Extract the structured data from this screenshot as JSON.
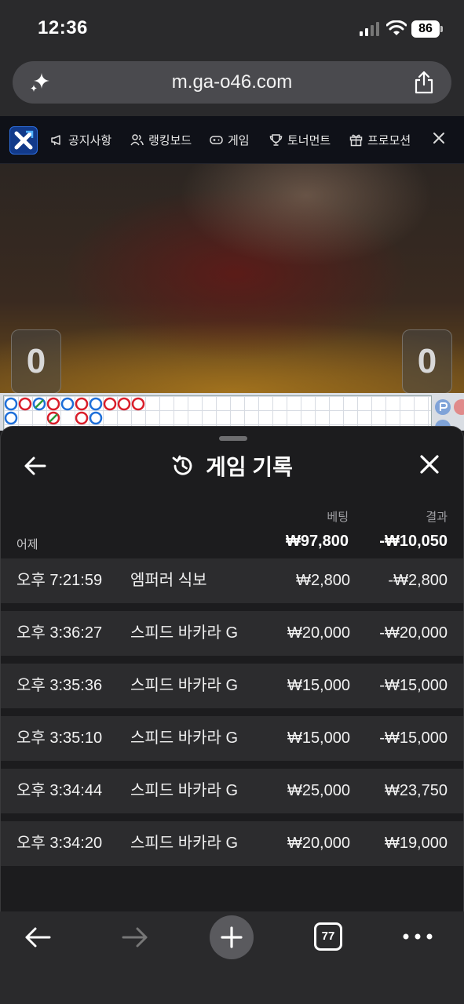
{
  "status_bar": {
    "time": "12:36",
    "battery": "86"
  },
  "browser": {
    "url": "m.ga-o46.com",
    "open_tabs": "77"
  },
  "site_nav": {
    "items": [
      {
        "label": "공지사항",
        "icon": "megaphone-icon"
      },
      {
        "label": "랭킹보드",
        "icon": "users-icon"
      },
      {
        "label": "게임",
        "icon": "gamepad-icon"
      },
      {
        "label": "토너먼트",
        "icon": "trophy-icon"
      },
      {
        "label": "프로모션",
        "icon": "gift-icon"
      }
    ]
  },
  "video": {
    "score_left": "0",
    "score_right": "0"
  },
  "game_history": {
    "title": "게임 기록",
    "col_bet": "베팅",
    "col_result": "결과",
    "summary": {
      "label": "어제",
      "bet": "₩97,800",
      "result": "-₩10,050"
    },
    "rows": [
      {
        "time": "오후 7:21:59",
        "game": "엠퍼러 식보",
        "bet": "₩2,800",
        "result": "-₩2,800"
      },
      {
        "time": "오후 3:36:27",
        "game": "스피드 바카라 G",
        "bet": "₩20,000",
        "result": "-₩20,000"
      },
      {
        "time": "오후 3:35:36",
        "game": "스피드 바카라 G",
        "bet": "₩15,000",
        "result": "-₩15,000"
      },
      {
        "time": "오후 3:35:10",
        "game": "스피드 바카라 G",
        "bet": "₩15,000",
        "result": "-₩15,000"
      },
      {
        "time": "오후 3:34:44",
        "game": "스피드 바카라 G",
        "bet": "₩25,000",
        "result": "₩23,750"
      },
      {
        "time": "오후 3:34:20",
        "game": "스피드 바카라 G",
        "bet": "₩20,000",
        "result": "₩19,000"
      }
    ]
  },
  "colors": {
    "player": "#1e6fd9",
    "banker": "#d91e2a",
    "panel_bg": "#1c1c1e",
    "row_bg": "#2c2c2e"
  }
}
